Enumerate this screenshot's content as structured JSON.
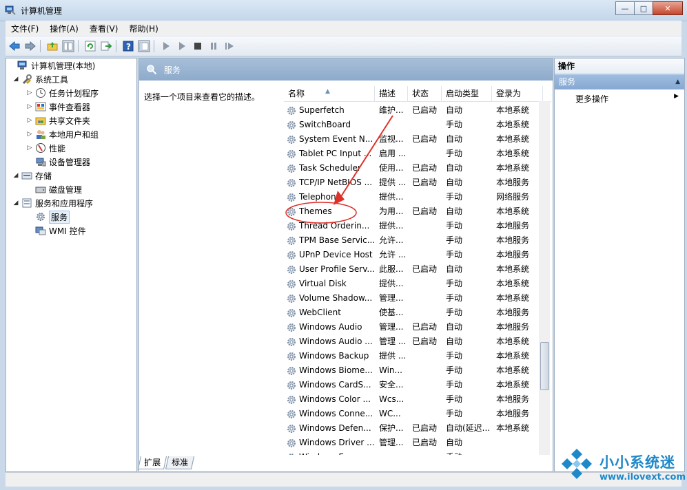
{
  "window": {
    "title": "计算机管理",
    "buttons": {
      "minimize": "—",
      "maximize": "□",
      "close": "✕"
    }
  },
  "menu": [
    {
      "label": "文件(F)"
    },
    {
      "label": "操作(A)"
    },
    {
      "label": "查看(V)"
    },
    {
      "label": "帮助(H)"
    }
  ],
  "toolbar": {
    "icons": [
      "back-icon",
      "forward-icon",
      "up-folder-icon",
      "show-hide-tree-icon",
      "refresh-icon",
      "export-icon",
      "help-icon",
      "console-view-icon",
      "start-service-icon",
      "start-icon",
      "stop-icon",
      "pause-icon",
      "restart-icon"
    ]
  },
  "tree": {
    "items": [
      {
        "label": "计算机管理(本地)",
        "icon": "computer-icon"
      },
      {
        "label": "系统工具",
        "icon": "tools-icon"
      },
      {
        "label": "任务计划程序",
        "icon": "clock-icon"
      },
      {
        "label": "事件查看器",
        "icon": "event-viewer-icon"
      },
      {
        "label": "共享文件夹",
        "icon": "shared-folder-icon"
      },
      {
        "label": "本地用户和组",
        "icon": "users-icon"
      },
      {
        "label": "性能",
        "icon": "performance-icon"
      },
      {
        "label": "设备管理器",
        "icon": "device-manager-icon"
      },
      {
        "label": "存储",
        "icon": "storage-icon"
      },
      {
        "label": "磁盘管理",
        "icon": "disk-icon"
      },
      {
        "label": "服务和应用程序",
        "icon": "services-apps-icon"
      },
      {
        "label": "服务",
        "icon": "services-icon"
      },
      {
        "label": "WMI 控件",
        "icon": "wmi-icon"
      }
    ]
  },
  "middle": {
    "header_title": "服务",
    "description_prompt": "选择一个项目来查看它的描述。",
    "columns": [
      "名称",
      "描述",
      "状态",
      "启动类型",
      "登录为"
    ],
    "rows": [
      {
        "name": "Superfetch",
        "desc": "维护...",
        "state": "已启动",
        "start": "自动",
        "logon": "本地系统"
      },
      {
        "name": "SwitchBoard",
        "desc": "",
        "state": "",
        "start": "手动",
        "logon": "本地系统"
      },
      {
        "name": "System Event N...",
        "desc": "监视...",
        "state": "已启动",
        "start": "自动",
        "logon": "本地系统"
      },
      {
        "name": "Tablet PC Input ...",
        "desc": "启用 ...",
        "state": "",
        "start": "手动",
        "logon": "本地系统"
      },
      {
        "name": "Task Scheduler",
        "desc": "使用...",
        "state": "已启动",
        "start": "自动",
        "logon": "本地系统"
      },
      {
        "name": "TCP/IP NetBIOS ...",
        "desc": "提供 ...",
        "state": "已启动",
        "start": "自动",
        "logon": "本地服务"
      },
      {
        "name": "Telephony",
        "desc": "提供...",
        "state": "",
        "start": "手动",
        "logon": "网络服务"
      },
      {
        "name": "Themes",
        "desc": "为用...",
        "state": "已启动",
        "start": "自动",
        "logon": "本地系统"
      },
      {
        "name": "Thread Orderin...",
        "desc": "提供...",
        "state": "",
        "start": "手动",
        "logon": "本地服务"
      },
      {
        "name": "TPM Base Servic...",
        "desc": "允许...",
        "state": "",
        "start": "手动",
        "logon": "本地服务"
      },
      {
        "name": "UPnP Device Host",
        "desc": "允许 ...",
        "state": "",
        "start": "手动",
        "logon": "本地服务"
      },
      {
        "name": "User Profile Serv...",
        "desc": "此服...",
        "state": "已启动",
        "start": "自动",
        "logon": "本地系统"
      },
      {
        "name": "Virtual Disk",
        "desc": "提供...",
        "state": "",
        "start": "手动",
        "logon": "本地系统"
      },
      {
        "name": "Volume Shadow...",
        "desc": "管理...",
        "state": "",
        "start": "手动",
        "logon": "本地系统"
      },
      {
        "name": "WebClient",
        "desc": "使基...",
        "state": "",
        "start": "手动",
        "logon": "本地服务"
      },
      {
        "name": "Windows Audio",
        "desc": "管理...",
        "state": "已启动",
        "start": "自动",
        "logon": "本地服务"
      },
      {
        "name": "Windows Audio ...",
        "desc": "管理 ...",
        "state": "已启动",
        "start": "自动",
        "logon": "本地系统"
      },
      {
        "name": "Windows Backup",
        "desc": "提供 ...",
        "state": "",
        "start": "手动",
        "logon": "本地系统"
      },
      {
        "name": "Windows Biome...",
        "desc": "Win...",
        "state": "",
        "start": "手动",
        "logon": "本地系统"
      },
      {
        "name": "Windows CardS...",
        "desc": "安全...",
        "state": "",
        "start": "手动",
        "logon": "本地系统"
      },
      {
        "name": "Windows Color ...",
        "desc": "Wcs...",
        "state": "",
        "start": "手动",
        "logon": "本地服务"
      },
      {
        "name": "Windows Conne...",
        "desc": "WC...",
        "state": "",
        "start": "手动",
        "logon": "本地服务"
      },
      {
        "name": "Windows Defen...",
        "desc": "保护...",
        "state": "已启动",
        "start": "自动(延迟...",
        "logon": "本地系统"
      },
      {
        "name": "Windows Driver ...",
        "desc": "管理...",
        "state": "已启动",
        "start": "自动",
        "logon": ""
      },
      {
        "name": "Windows E...",
        "desc": "...",
        "state": "",
        "start": "手动",
        "logon": ""
      }
    ],
    "tabs": [
      "扩展",
      "标准"
    ]
  },
  "actions": {
    "title": "操作",
    "section": "服务",
    "more": "更多操作"
  },
  "watermark": {
    "text_cn": "小小系统迷",
    "url": "www.ilovext.com"
  },
  "colors": {
    "header_blue": "#8eaacb",
    "annotation_red": "#e0302a",
    "watermark_blue": "#1e88c9"
  }
}
